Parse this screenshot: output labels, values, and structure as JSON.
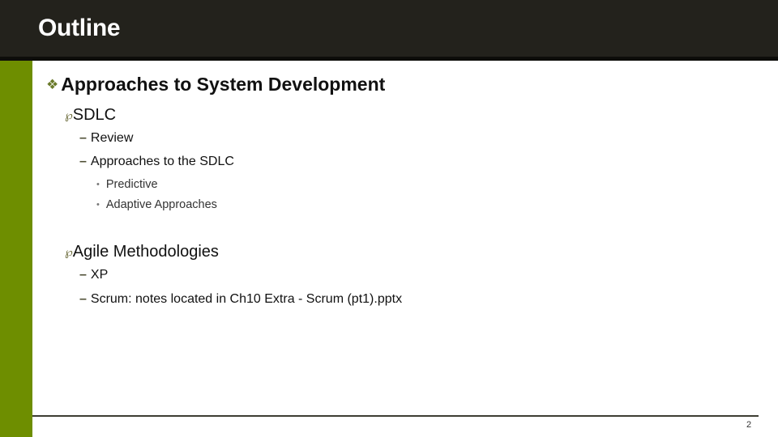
{
  "slide": {
    "title": "Outline",
    "page_number": "2",
    "colors": {
      "header": "#23221c",
      "sidebar": "#6e8e00",
      "bullet": "#6a7a2a"
    }
  },
  "outline": {
    "heading": {
      "icon": "four-diamond-bullet-icon",
      "glyph": "❖",
      "text": "Approaches to System Development"
    },
    "sections": [
      {
        "glyph": "℘",
        "text": "SDLC",
        "items": [
          {
            "glyph": "–",
            "text": "Review"
          },
          {
            "glyph": "–",
            "text": "Approaches to the SDLC",
            "subitems": [
              {
                "glyph": "•",
                "text": "Predictive"
              },
              {
                "glyph": "•",
                "text": "Adaptive Approaches"
              }
            ]
          }
        ]
      },
      {
        "glyph": "℘",
        "text": "Agile Methodologies",
        "items": [
          {
            "glyph": "–",
            "text": "XP"
          },
          {
            "glyph": "–",
            "text": "Scrum: notes located in Ch10 Extra - Scrum (pt1).pptx"
          }
        ]
      }
    ]
  }
}
